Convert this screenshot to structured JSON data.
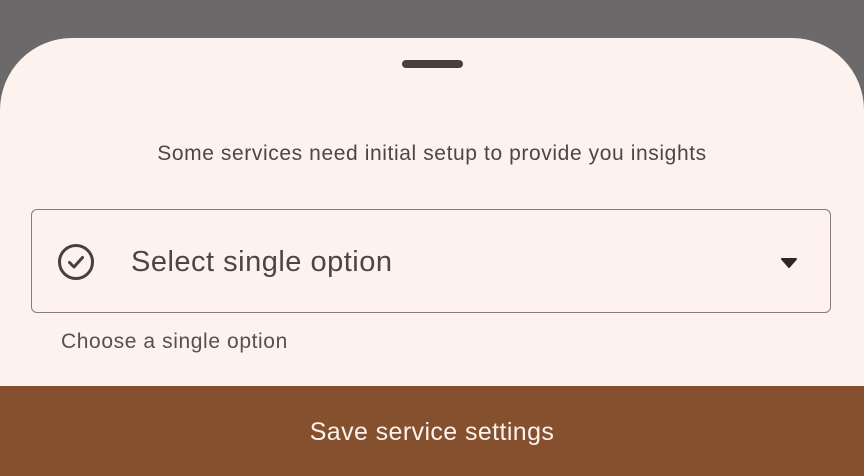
{
  "sheet": {
    "subtitle": "Some services need initial setup to provide you insights"
  },
  "select": {
    "leading_icon": "check-circle-icon",
    "placeholder": "Select single option",
    "trailing_icon": "arrow-drop-down-icon",
    "helper_text": "Choose a single option"
  },
  "footer": {
    "save_label": "Save service settings"
  },
  "colors": {
    "scrim": "#6b6969",
    "sheet_background": "#fdf2ed",
    "text": "#4f4542",
    "outline": "#8a7c76",
    "primary": "#85502e",
    "on_primary": "#fdf2ed"
  }
}
